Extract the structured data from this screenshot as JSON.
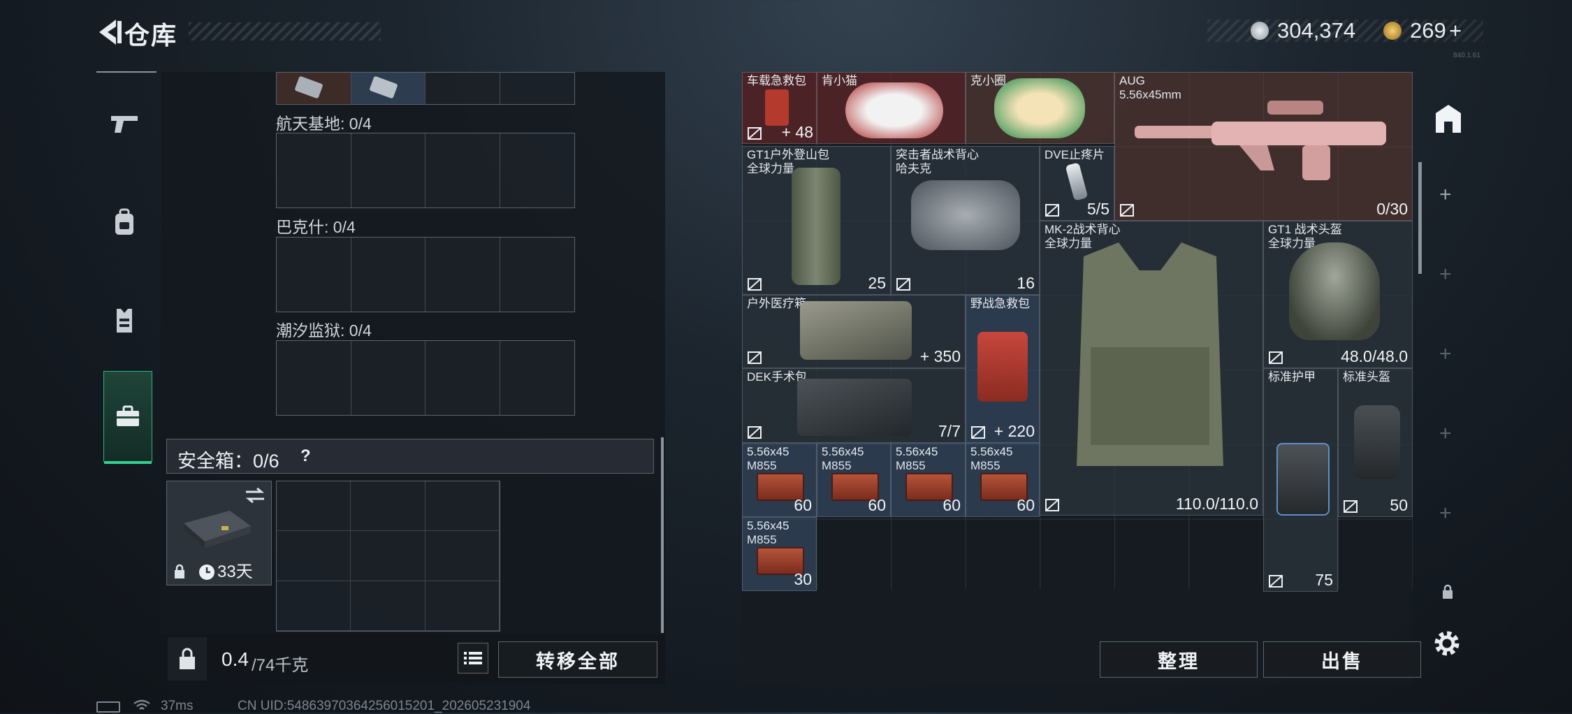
{
  "header": {
    "title": "仓库",
    "currency_silver": "304,374",
    "currency_gold": "269",
    "gold_add": "+",
    "version": "840.1.61"
  },
  "colors": {
    "accent": "#31d18c",
    "bg": "#141a21",
    "panel": "#1c232b"
  },
  "tabs": [
    {
      "icon": "pistol-icon",
      "active": false
    },
    {
      "icon": "backpack-icon",
      "active": false
    },
    {
      "icon": "vest-icon",
      "active": false
    },
    {
      "icon": "briefcase-icon",
      "active": true
    }
  ],
  "collections": [
    {
      "label": "航天基地: 0/4"
    },
    {
      "label": "巴克什: 0/4"
    },
    {
      "label": "潮汐监狱: 0/4"
    }
  ],
  "safe_box": {
    "label": "安全箱：0/6",
    "help": "?",
    "days": "33天",
    "weight": "0.4",
    "weight_max": "/74千克",
    "transfer_all": "转移全部"
  },
  "inventory": {
    "items": [
      {
        "name": "车载急救包",
        "value": "+ 48"
      },
      {
        "name": "肯小猫",
        "value": ""
      },
      {
        "name": "克小圈",
        "value": ""
      },
      {
        "name": "AUG",
        "sub": "5.56x45mm",
        "value": "0/30"
      },
      {
        "name": "GT1户外登山包",
        "sub": "全球力量",
        "value": "25"
      },
      {
        "name": "突击者战术背心",
        "sub": "哈夫克",
        "value": "16"
      },
      {
        "name": "DVE止疼片",
        "value": "5/5"
      },
      {
        "name": "MK-2战术背心",
        "sub": "全球力量",
        "value": "110.0/110.0"
      },
      {
        "name": "GT1 战术头盔",
        "sub": "全球力量",
        "value": "48.0/48.0"
      },
      {
        "name": "户外医疗箱",
        "value": "+ 350"
      },
      {
        "name": "野战急救包",
        "value": "+ 220"
      },
      {
        "name": "DEK手术包",
        "value": "7/7"
      },
      {
        "name": "标准护甲",
        "value": "75"
      },
      {
        "name": "标准头盔",
        "value": "50"
      },
      {
        "name": "5.56x45",
        "sub": "M855",
        "value": "60"
      },
      {
        "name": "5.56x45",
        "sub": "M855",
        "value": "60"
      },
      {
        "name": "5.56x45",
        "sub": "M855",
        "value": "60"
      },
      {
        "name": "5.56x45",
        "sub": "M855",
        "value": "60"
      },
      {
        "name": "5.56x45",
        "sub": "M855",
        "value": "30"
      }
    ],
    "sort_button": "整理",
    "sell_button": "出售"
  },
  "status": {
    "ping": "37ms",
    "uid": "CN UID:5486397036425601​5201_202605231904"
  }
}
